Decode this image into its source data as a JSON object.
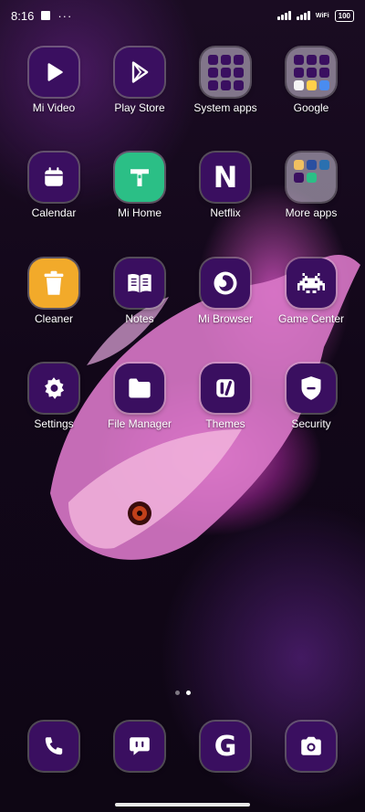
{
  "status": {
    "time": "8:16",
    "more": "···",
    "wifi": "WiFi",
    "battery": "100"
  },
  "apps": [
    {
      "label": "Mi Video",
      "icon": "play-icon"
    },
    {
      "label": "Play Store",
      "icon": "play-store-icon"
    },
    {
      "label": "System apps",
      "icon": "folder-icon"
    },
    {
      "label": "Google",
      "icon": "folder-icon"
    },
    {
      "label": "Calendar",
      "icon": "calendar-icon"
    },
    {
      "label": "Mi Home",
      "icon": "mi-home-icon"
    },
    {
      "label": "Netflix",
      "icon": "netflix-icon"
    },
    {
      "label": "More apps",
      "icon": "folder-icon"
    },
    {
      "label": "Cleaner",
      "icon": "trash-icon"
    },
    {
      "label": "Notes",
      "icon": "book-icon"
    },
    {
      "label": "Mi Browser",
      "icon": "browser-icon"
    },
    {
      "label": "Game Center",
      "icon": "game-icon"
    },
    {
      "label": "Settings",
      "icon": "gear-icon"
    },
    {
      "label": "File Manager",
      "icon": "folder-file-icon"
    },
    {
      "label": "Themes",
      "icon": "themes-icon"
    },
    {
      "label": "Security",
      "icon": "shield-icon"
    }
  ],
  "netflix_letter": "N",
  "google_letter": "G",
  "dock": [
    {
      "icon": "phone-icon"
    },
    {
      "icon": "messages-icon"
    },
    {
      "icon": "google-icon"
    },
    {
      "icon": "camera-icon"
    }
  ],
  "colors": {
    "icon_bg": "#3a0f60",
    "cleaner": "#f2aa2a",
    "mi_home": "#2bbf86"
  }
}
